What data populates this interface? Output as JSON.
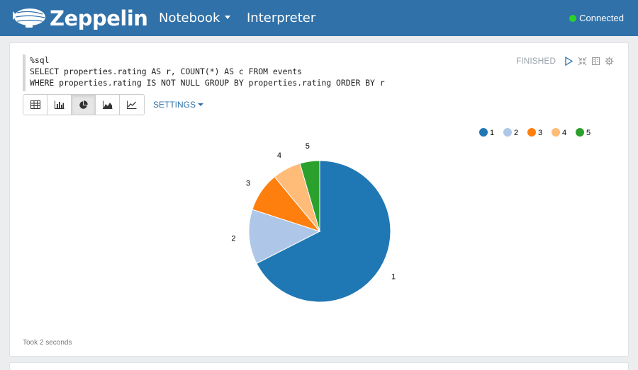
{
  "navbar": {
    "brand": "Zeppelin",
    "notebook_label": "Notebook",
    "interpreter_label": "Interpreter",
    "status": "Connected",
    "status_color": "#2cd328"
  },
  "paragraph": {
    "code_lines": [
      "%sql",
      "SELECT properties.rating AS r, COUNT(*) AS c FROM events",
      "WHERE properties.rating IS NOT NULL GROUP BY properties.rating ORDER BY r"
    ],
    "state": "FINISHED",
    "controls": [
      "play-icon",
      "expand-icon",
      "book-icon",
      "gear-icon"
    ],
    "toolbar": [
      {
        "name": "table-icon",
        "active": false
      },
      {
        "name": "bar-chart-icon",
        "active": false
      },
      {
        "name": "pie-chart-icon",
        "active": true
      },
      {
        "name": "area-chart-icon",
        "active": false
      },
      {
        "name": "line-chart-icon",
        "active": false
      }
    ],
    "settings_label": "SETTINGS",
    "took": "Took 2 seconds"
  },
  "chart_data": {
    "type": "pie",
    "categories": [
      "1",
      "2",
      "3",
      "4",
      "5"
    ],
    "values": [
      67.5,
      12.5,
      9,
      6.5,
      4.5
    ],
    "colors": [
      "#1f77b4",
      "#aec7e8",
      "#ff7f0e",
      "#ffbb78",
      "#2ca02c"
    ],
    "legend": [
      "1",
      "2",
      "3",
      "4",
      "5"
    ],
    "legend_position": "top-right"
  }
}
